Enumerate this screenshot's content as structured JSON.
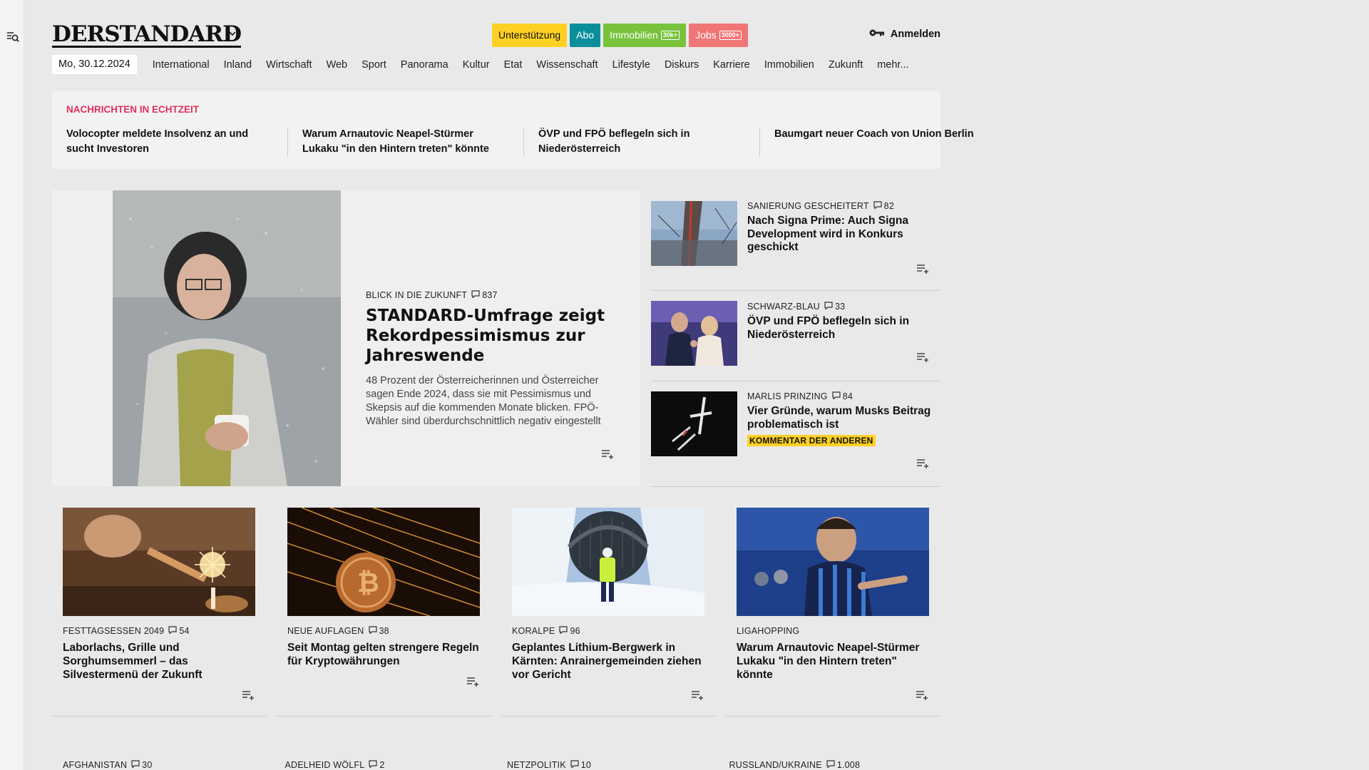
{
  "logo": {
    "text": "DERSTANDARD"
  },
  "promo": [
    {
      "label": "Unterstützung",
      "bg": "#ffd024",
      "fg": "#111111",
      "badge": ""
    },
    {
      "label": "Abo",
      "bg": "#0a8f9a",
      "fg": "#ffffff",
      "badge": ""
    },
    {
      "label": "Immobilien",
      "bg": "#78c23c",
      "fg": "#ffffff",
      "badge": "30k+"
    },
    {
      "label": "Jobs",
      "bg": "#f07575",
      "fg": "#ffffff",
      "badge": "3000+"
    }
  ],
  "login": {
    "label": "Anmelden",
    "icon": "key-icon"
  },
  "nav": {
    "date": "Mo, 30.12.2024",
    "items": [
      "International",
      "Inland",
      "Wirtschaft",
      "Web",
      "Sport",
      "Panorama",
      "Kultur",
      "Etat",
      "Wissenschaft",
      "Lifestyle",
      "Diskurs",
      "Karriere",
      "Immobilien",
      "Zukunft",
      "mehr..."
    ]
  },
  "ticker": {
    "title": "NACHRICHTEN IN ECHTZEIT",
    "items": [
      "Volocopter meldete Insolvenz an und sucht Investoren",
      "Warum Arnautovic Neapel-Stürmer Lukaku \"in den Hintern treten\" könnte",
      "ÖVP und FPÖ beflegeln sich in Niederösterreich",
      "Baumgart neuer Coach von Union Berlin"
    ]
  },
  "hero": {
    "kicker": "BLICK IN DIE ZUKUNFT",
    "comments": "837",
    "title": "STANDARD-Umfrage zeigt Re­kordpessimismus zur Jahreswende",
    "lead": "48 Prozent der Österreicherinnen und Österreicher sagen Ende 2024, dass sie mit Pessimismus und Skepsis auf die kommenden Monate blicken. FPÖ-Wähler sind überdurchschnittlich negativ eingestellt"
  },
  "side": [
    {
      "kicker": "SANIERUNG GESCHEITERT",
      "comments": "82",
      "title": "Nach Signa Prime: Auch Signa Development wird in Konkurs geschickt",
      "tag": ""
    },
    {
      "kicker": "SCHWARZ-BLAU",
      "comments": "33",
      "title": "ÖVP und FPÖ beflegeln sich in Niederösterreich",
      "tag": ""
    },
    {
      "kicker": "MARLIS PRINZING",
      "comments": "84",
      "title": "Vier Gründe, warum Musks Beitrag problematisch ist",
      "tag": "KOMMENTAR DER ANDEREN"
    }
  ],
  "cards": [
    {
      "kicker": "FESTTAGSESSEN 2049",
      "comments": "54",
      "title": "Laborlachs, Grille und Sorghumsemmerl – das Silvestermenü der Zukunft"
    },
    {
      "kicker": "NEUE AUFLAGEN",
      "comments": "38",
      "title": "Seit Montag gelten strengere Regeln für Kryptowährungen"
    },
    {
      "kicker": "KORALPE",
      "comments": "96",
      "title": "Geplantes Lithium-Bergwerk in Kärnten: Anrainergemeinden ziehen vor Gericht"
    },
    {
      "kicker": "LIGAHOPPING",
      "comments": "",
      "title": "Warum Arnautovic Neapel-Stürmer Lukaku \"in den Hintern treten\" könnte"
    }
  ],
  "row2": [
    {
      "kicker": "AFGHANISTAN",
      "comments": "30"
    },
    {
      "kicker": "ADELHEID WÖLFL",
      "comments": "2"
    },
    {
      "kicker": "NETZPOLITIK",
      "comments": "10"
    },
    {
      "kicker": "RUSSLAND/UKRAINE",
      "comments": "1.008"
    }
  ]
}
